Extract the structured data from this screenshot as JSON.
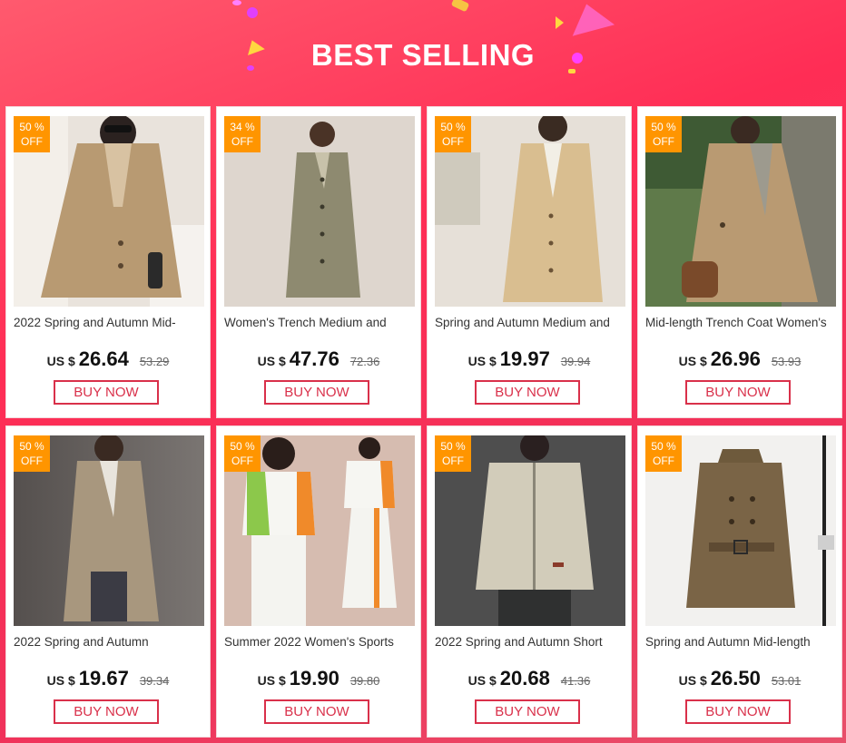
{
  "header": {
    "title": "BEST SELLING"
  },
  "colors": {
    "accent": "#ff2d55",
    "badge": "#ff9500",
    "button_border": "#d9304a"
  },
  "products": [
    {
      "badge": [
        "50 %",
        "OFF"
      ],
      "name": "2022 Spring and Autumn Mid-",
      "currency": "US $",
      "price": "26.64",
      "old_price": "53.29",
      "button": "BUY NOW"
    },
    {
      "badge": [
        "34 %",
        "OFF"
      ],
      "name": "Women's Trench Medium and",
      "currency": "US $",
      "price": "47.76",
      "old_price": "72.36",
      "button": "BUY NOW"
    },
    {
      "badge": [
        "50 %",
        "OFF"
      ],
      "name": "Spring and Autumn Medium and",
      "currency": "US $",
      "price": "19.97",
      "old_price": "39.94",
      "button": "BUY NOW"
    },
    {
      "badge": [
        "50 %",
        "OFF"
      ],
      "name": "Mid-length Trench Coat Women's",
      "currency": "US $",
      "price": "26.96",
      "old_price": "53.93",
      "button": "BUY NOW"
    },
    {
      "badge": [
        "50 %",
        "OFF"
      ],
      "name": "2022 Spring and Autumn",
      "currency": "US $",
      "price": "19.67",
      "old_price": "39.34",
      "button": "BUY NOW"
    },
    {
      "badge": [
        "50 %",
        "OFF"
      ],
      "name": "Summer 2022 Women's Sports",
      "currency": "US $",
      "price": "19.90",
      "old_price": "39.80",
      "button": "BUY NOW"
    },
    {
      "badge": [
        "50 %",
        "OFF"
      ],
      "name": "2022 Spring and Autumn Short",
      "currency": "US $",
      "price": "20.68",
      "old_price": "41.36",
      "button": "BUY NOW"
    },
    {
      "badge": [
        "50 %",
        "OFF"
      ],
      "name": "Spring and Autumn Mid-length",
      "currency": "US $",
      "price": "26.50",
      "old_price": "53.01",
      "button": "BUY NOW"
    }
  ]
}
